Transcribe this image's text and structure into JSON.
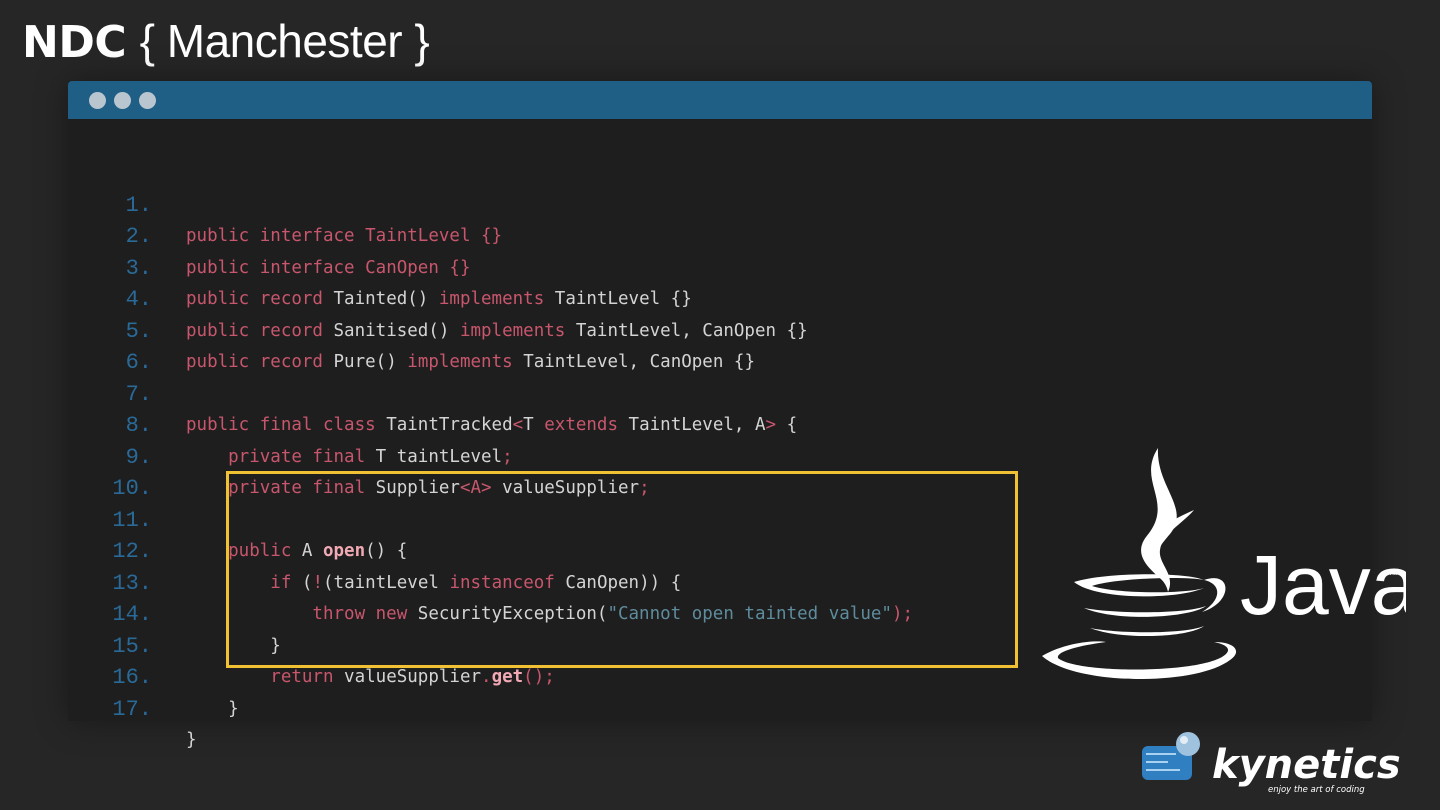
{
  "brand": {
    "event": "NDC",
    "city": "{ Manchester }"
  },
  "window": {
    "title_dots": 3
  },
  "code": {
    "line_numbers": [
      "1.",
      "2.",
      "3.",
      "4.",
      "5.",
      "6.",
      "7.",
      "8.",
      "9.",
      "10.",
      "11.",
      "12.",
      "13.",
      "14.",
      "15.",
      "16.",
      "17."
    ],
    "l1": {
      "a": "public interface ",
      "b": "TaintLevel {}"
    },
    "l2": {
      "a": "public interface ",
      "b": "CanOpen {}"
    },
    "l3": {
      "a": "public record ",
      "b": "Tainted() ",
      "c": "implements ",
      "d": "TaintLevel {}"
    },
    "l4": {
      "a": "public record ",
      "b": "Sanitised() ",
      "c": "implements ",
      "d": "TaintLevel, CanOpen {}"
    },
    "l5": {
      "a": "public record ",
      "b": "Pure() ",
      "c": "implements ",
      "d": "TaintLevel, CanOpen {}"
    },
    "l7": {
      "a": "public final class ",
      "b": "TaintTracked",
      "c": "<",
      "d": "T ",
      "e": "extends ",
      "f": "TaintLevel, A",
      "g": ">",
      "h": " {"
    },
    "l8": {
      "a": "    private final ",
      "b": "T taintLevel",
      "c": ";"
    },
    "l9": {
      "a": "    private final ",
      "b": "Supplier",
      "c": "<A>",
      "d": " valueSupplier",
      "e": ";"
    },
    "l11": {
      "a": "    public ",
      "b": "A ",
      "c": "open",
      "d": "() {"
    },
    "l12": {
      "a": "        if ",
      "b": "(",
      "c": "!",
      "d": "(taintLevel ",
      "e": "instanceof ",
      "f": "CanOpen)) {"
    },
    "l13": {
      "a": "            throw new ",
      "b": "SecurityException(",
      "c": "\"Cannot open tainted value\"",
      "d": ");"
    },
    "l14": {
      "a": "        }"
    },
    "l15": {
      "a": "        return ",
      "b": "valueSupplier",
      "c": ".",
      "d": "get",
      "e": "();"
    },
    "l16": {
      "a": "    }"
    },
    "l17": {
      "a": "}"
    }
  },
  "logos": {
    "java": {
      "wordmark": "Java",
      "tm": "™"
    },
    "kynetics": {
      "name": "kynetics",
      "tagline": "enjoy the art of coding"
    }
  },
  "colors": {
    "keyword": "#c8566c",
    "text": "#d4d4d4",
    "string": "#5e8c9c",
    "line_number": "#2a6a98",
    "titlebar": "#1f5f86",
    "highlight_border": "#f0c132"
  }
}
